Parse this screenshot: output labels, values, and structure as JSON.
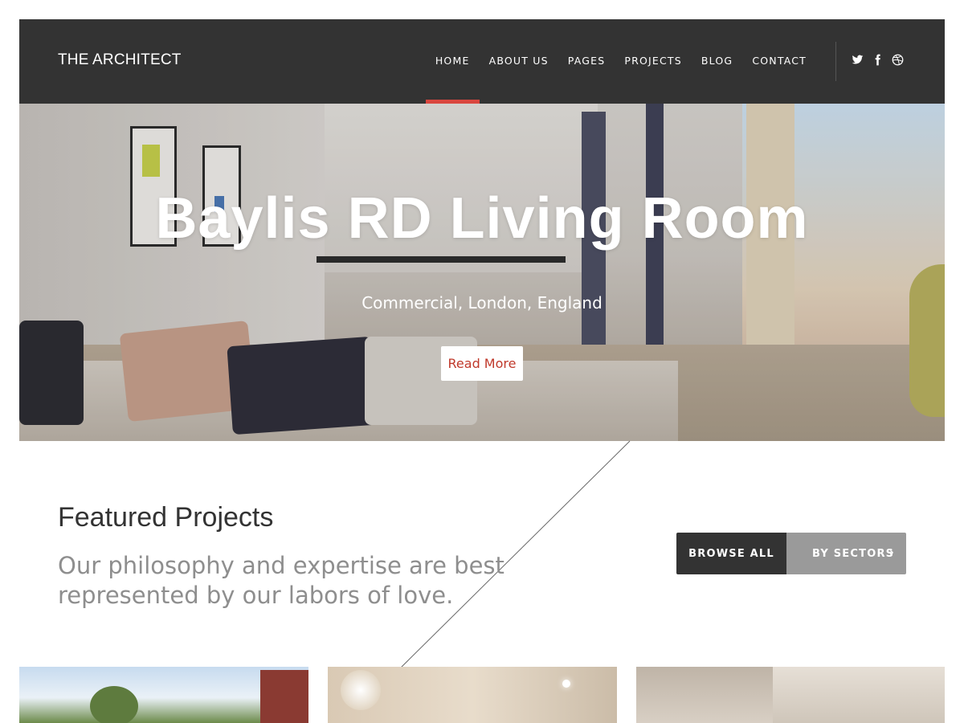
{
  "header": {
    "logo": "THE ARCHITECT",
    "nav": [
      "HOME",
      "ABOUT US",
      "PAGES",
      "PROJECTS",
      "BLOG",
      "CONTACT"
    ],
    "active_nav": "HOME",
    "accent_color": "#d9463f",
    "social_icons": [
      "twitter-icon",
      "facebook-icon",
      "dribbble-icon"
    ]
  },
  "hero": {
    "title": "Baylis RD Living Room",
    "subtitle": "Commercial, London, England",
    "button": "Read More",
    "button_color": "#c0392b"
  },
  "featured": {
    "title": "Featured Projects",
    "description": "Our philosophy and expertise are best represented by our labors of love.",
    "browse_all": "BROWSE ALL",
    "by_sectors": "BY SECTORS",
    "chevron": "›"
  }
}
